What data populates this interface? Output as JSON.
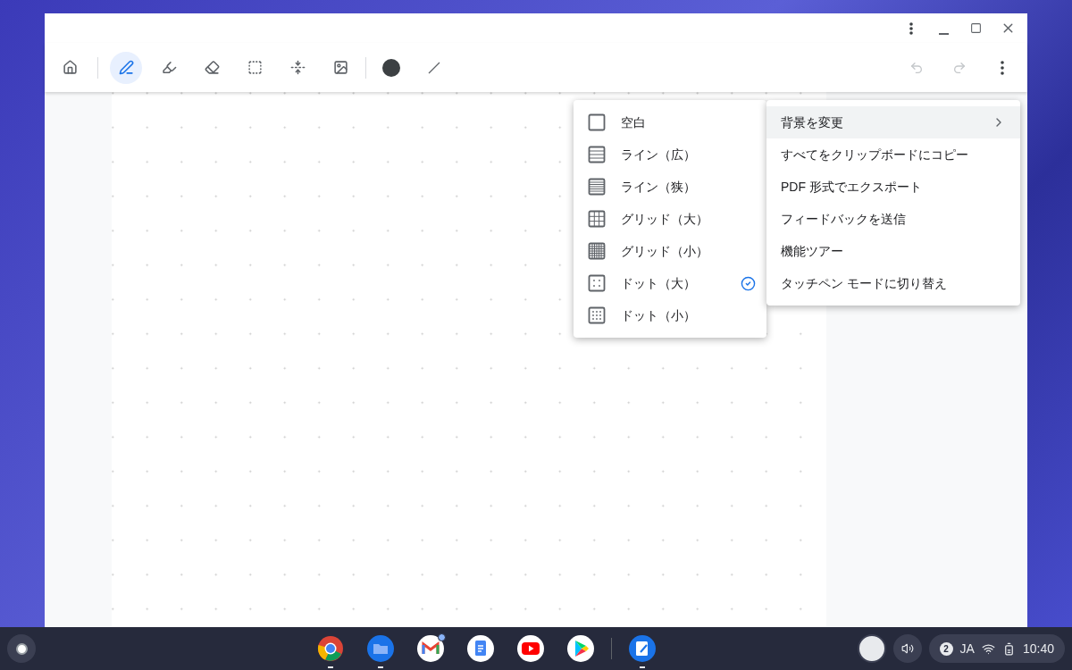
{
  "toolbar": {
    "tools": [
      {
        "kind": "home",
        "selected": false
      },
      {
        "kind": "pen",
        "selected": true
      },
      {
        "kind": "highlighter",
        "selected": false
      },
      {
        "kind": "eraser",
        "selected": false
      },
      {
        "kind": "select",
        "selected": false
      },
      {
        "kind": "space",
        "selected": false
      },
      {
        "kind": "image",
        "selected": false
      },
      {
        "kind": "color",
        "selected": false
      },
      {
        "kind": "width",
        "selected": false
      }
    ],
    "history": [
      {
        "kind": "undo",
        "disabled": true
      },
      {
        "kind": "redo",
        "disabled": true
      }
    ]
  },
  "background_menu": {
    "items": [
      {
        "kind": "blank",
        "label": "空白",
        "selected": false
      },
      {
        "kind": "lines-wide",
        "label": "ライン（広）",
        "selected": false
      },
      {
        "kind": "lines-narrow",
        "label": "ライン（狭）",
        "selected": false
      },
      {
        "kind": "grid-large",
        "label": "グリッド（大）",
        "selected": false
      },
      {
        "kind": "grid-small",
        "label": "グリッド（小）",
        "selected": false
      },
      {
        "kind": "dots-large",
        "label": "ドット（大）",
        "selected": true
      },
      {
        "kind": "dots-small",
        "label": "ドット（小）",
        "selected": false
      }
    ]
  },
  "main_menu": {
    "items": [
      {
        "label": "背景を変更",
        "submenu": true,
        "selected": true
      },
      {
        "label": "すべてをクリップボードにコピー",
        "submenu": false,
        "selected": false
      },
      {
        "label": "PDF 形式でエクスポート",
        "submenu": false,
        "selected": false
      },
      {
        "label": "フィードバックを送信",
        "submenu": false,
        "selected": false
      },
      {
        "label": "機能ツアー",
        "submenu": false,
        "selected": false
      },
      {
        "label": "タッチペン モードに切り替え",
        "submenu": false,
        "selected": false
      }
    ]
  },
  "shelf": {
    "apps": [
      {
        "kind": "chrome",
        "running": true,
        "badge": false
      },
      {
        "kind": "files",
        "running": true,
        "badge": false
      },
      {
        "kind": "gmail",
        "running": false,
        "badge": true
      },
      {
        "kind": "docs",
        "running": false,
        "badge": false
      },
      {
        "kind": "youtube",
        "running": false,
        "badge": false
      },
      {
        "kind": "play",
        "running": false,
        "badge": false
      },
      {
        "kind": "canvas",
        "running": true,
        "badge": false
      }
    ],
    "notification_count": "2",
    "input_method": "JA",
    "time": "10:40"
  }
}
